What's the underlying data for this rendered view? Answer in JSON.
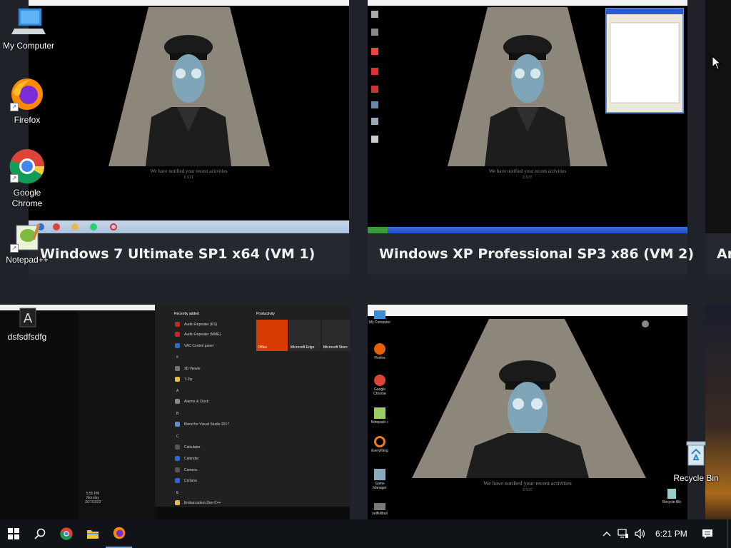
{
  "desktop": {
    "icons": [
      {
        "label": "My Computer"
      },
      {
        "label": "Firefox"
      },
      {
        "label": "Google Chrome"
      },
      {
        "label": "Notepad++"
      },
      {
        "label": "dsfsdfsdfg"
      },
      {
        "label": "Recycle Bin"
      }
    ]
  },
  "vms": [
    {
      "title": "Windows 7 Ultimate SP1 x64 (VM 1)",
      "caption": "We have notified your recent activities",
      "caption2": "EXIT"
    },
    {
      "title": "Windows XP Professional SP3 x86 (VM 2)",
      "caption": "We have notified your recent activities",
      "caption2": "EXIT"
    },
    {
      "title": "Ar"
    },
    {
      "caption": "We have notified your recent activities",
      "caption2": "EXIT",
      "icons": [
        "My Computer",
        "Firefox",
        "Google Chrome",
        "Notepad++",
        "Everything",
        "Game Manager",
        "selfkillbull",
        "Recycle Bin"
      ]
    }
  ],
  "startmenu": {
    "recently_added": "Recently added",
    "productivity": "Productivity",
    "items": [
      "Audio Repeater (KS)",
      "Audio Repeater (MME)",
      "VAC Control panel",
      "#",
      "3D Viewer",
      "7-Zip",
      "A",
      "Alarms & Clock",
      "B",
      "Blend for Visual Studio 2017",
      "C",
      "Calculator",
      "Calendar",
      "Camera",
      "Cortana",
      "E",
      "Embarcadero Dev-C++"
    ],
    "tiles": [
      "Office",
      "Microsoft Edge",
      "Microsoft Store"
    ],
    "clock": {
      "time": "5:55 PM",
      "day": "Monday",
      "date": "3/27/2023"
    }
  },
  "taskbar": {
    "time": "6:21 PM",
    "colors": {
      "background": "#101418",
      "accent": "#0078d7"
    }
  },
  "colors": {
    "tile_background": "#25292f",
    "desktop_background": "#1f2329",
    "spotlight": "#8c877a"
  }
}
